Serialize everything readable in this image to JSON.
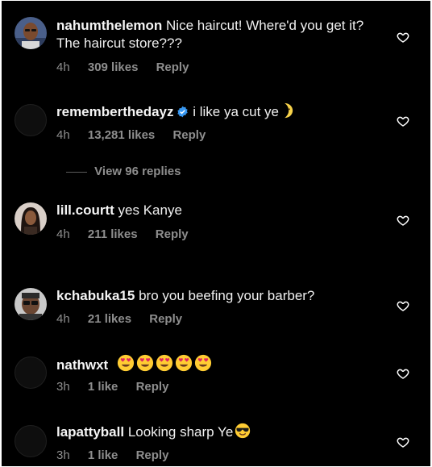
{
  "colors": {
    "background": "#000000",
    "text": "#f5f5f5",
    "meta": "#8e8e8e",
    "verified": "#3897f0"
  },
  "comments": [
    {
      "username": "nahumthelemon",
      "text": "Nice haircut! Where'd you get it? The haircut store???",
      "time": "4h",
      "likes": "309 likes",
      "reply": "Reply",
      "avatar": "photo"
    },
    {
      "username": "rememberthedayz",
      "verified": true,
      "verified_icon": "verified-badge-icon",
      "text": "i like ya cut ye",
      "emoji": "crescent-moon-face-icon",
      "time": "4h",
      "likes": "13,281 likes",
      "reply": "Reply",
      "avatar": "empty"
    },
    {
      "username": "lill.courtt",
      "text": "yes Kanye",
      "time": "4h",
      "likes": "211 likes",
      "reply": "Reply",
      "avatar": "photo"
    },
    {
      "username": "kchabuka15",
      "text": "bro you beefing your barber?",
      "time": "4h",
      "likes": "21 likes",
      "reply": "Reply",
      "avatar": "photo"
    },
    {
      "username": "nathwxt",
      "text": "",
      "emoji": "heart-eyes-face-icon",
      "emoji_count": 5,
      "time": "3h",
      "likes": "1 like",
      "reply": "Reply",
      "avatar": "empty"
    },
    {
      "username": "lapattyball",
      "text": "Looking sharp Ye",
      "emoji": "sunglasses-face-icon",
      "time": "3h",
      "likes": "1 like",
      "reply": "Reply",
      "avatar": "empty"
    }
  ],
  "view_replies": "View 96 replies",
  "heart_icon": "heart-outline-icon"
}
